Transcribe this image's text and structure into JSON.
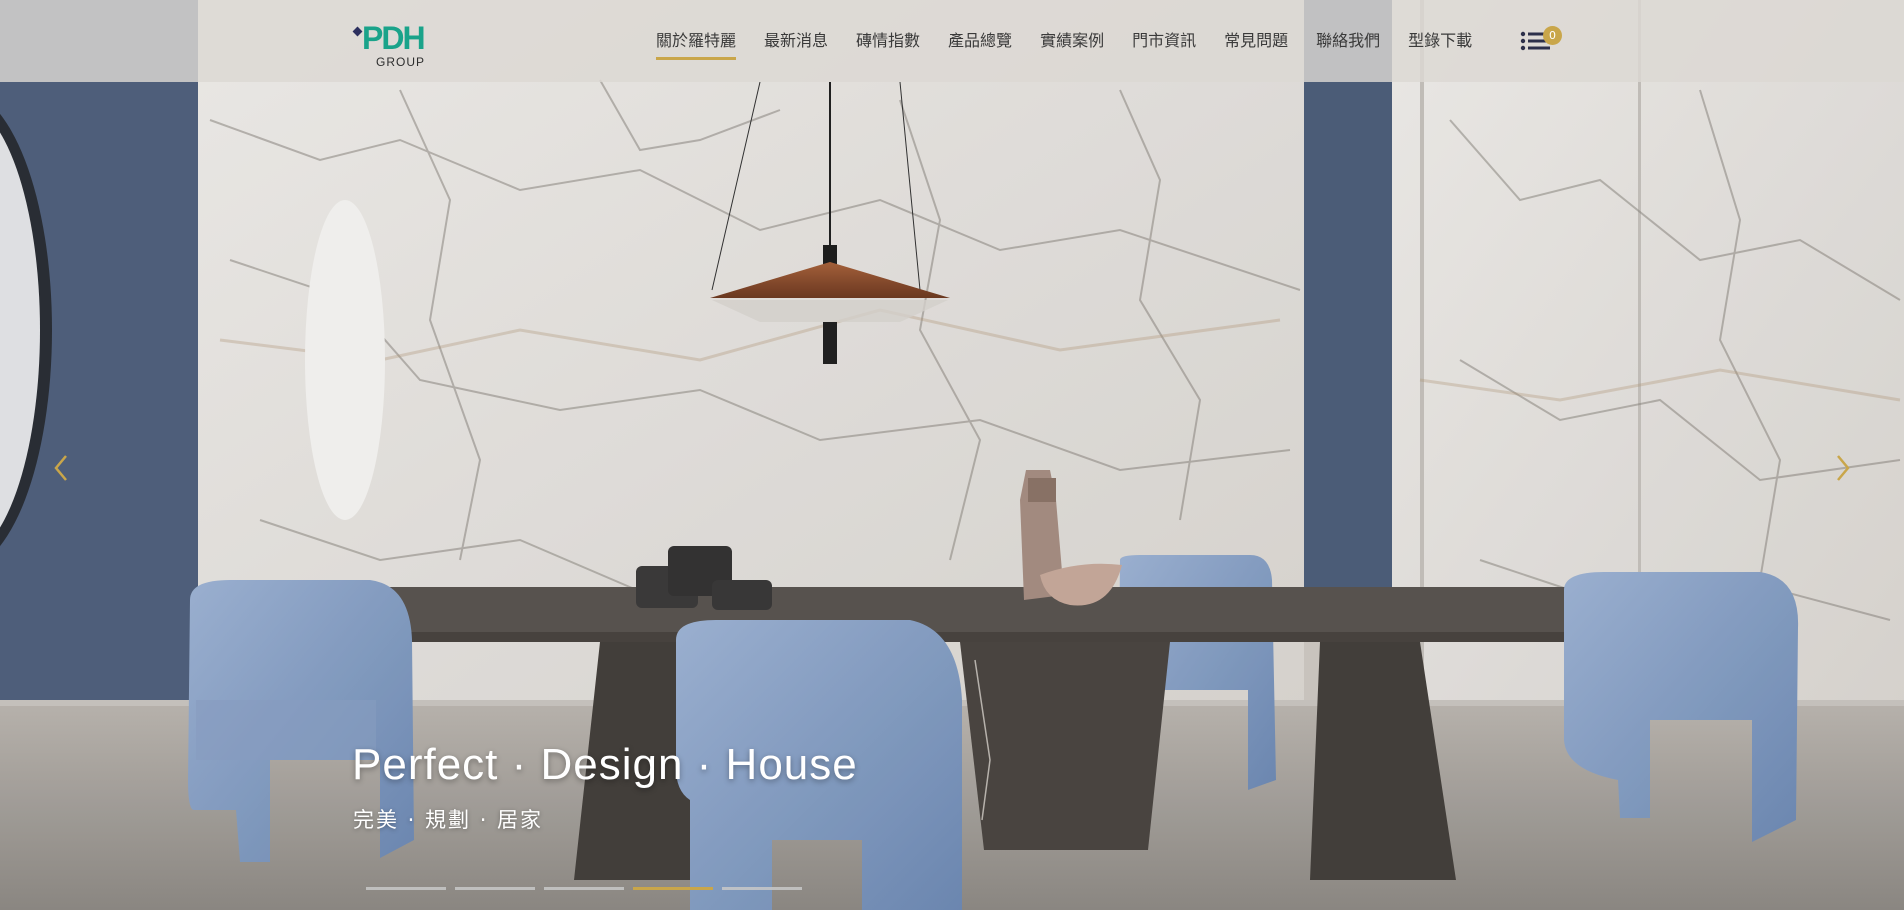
{
  "brand": {
    "logo_text": "PDH",
    "logo_subtext": "GROUP",
    "accent_color": "#c9a64a",
    "logo_color": "#1aa38a"
  },
  "nav": {
    "items": [
      {
        "label": "關於羅特麗",
        "active": true
      },
      {
        "label": "最新消息",
        "active": false
      },
      {
        "label": "磚情指數",
        "active": false
      },
      {
        "label": "產品總覽",
        "active": false
      },
      {
        "label": "實績案例",
        "active": false
      },
      {
        "label": "門市資訊",
        "active": false
      },
      {
        "label": "常見問題",
        "active": false
      },
      {
        "label": "聯絡我們",
        "active": false
      },
      {
        "label": "型錄下載",
        "active": false
      }
    ],
    "menu_icon": "list-menu-icon",
    "badge_count": "0"
  },
  "hero": {
    "title": "Perfect · Design · House",
    "subtitle": "完美 · 規劃 · 居家",
    "prev_icon": "chevron-left-icon",
    "next_icon": "chevron-right-icon",
    "slide_count": 5,
    "active_slide": 4
  }
}
